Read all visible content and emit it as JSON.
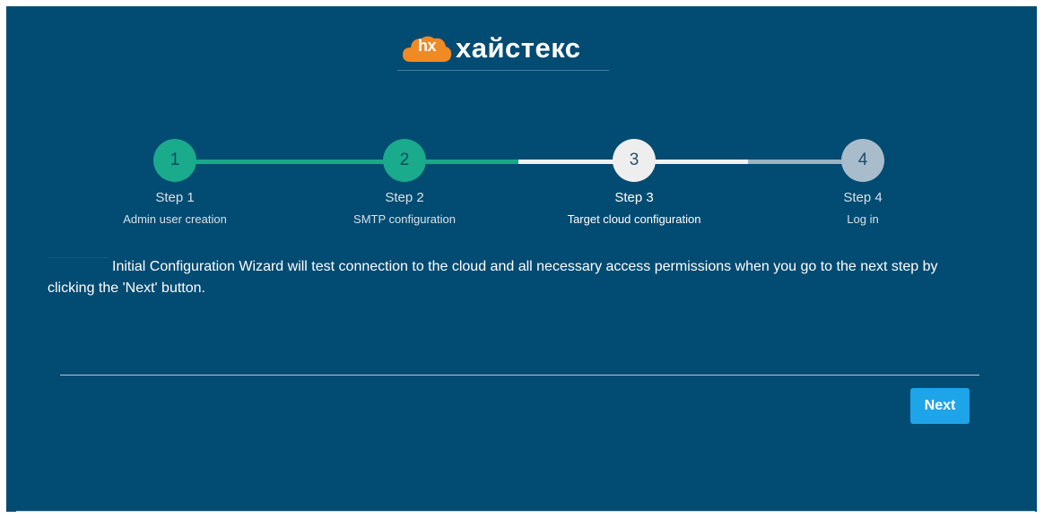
{
  "logo": {
    "mark_text": "hx",
    "word": "хайстекс",
    "cloud_color": "#f08a24"
  },
  "stepper": {
    "current_step": 3,
    "steps": [
      {
        "number": "1",
        "title": "Step 1",
        "subtitle": "Admin user creation",
        "status": "done"
      },
      {
        "number": "2",
        "title": "Step 2",
        "subtitle": "SMTP configuration",
        "status": "done"
      },
      {
        "number": "3",
        "title": "Step 3",
        "subtitle": "Target cloud configuration",
        "status": "current"
      },
      {
        "number": "4",
        "title": "Step 4",
        "subtitle": "Log in",
        "status": "future"
      }
    ]
  },
  "message": {
    "text": "Initial Configuration Wizard will test connection to the cloud and all necessary access permissions when you go to the next step by clicking the 'Next' button."
  },
  "footer": {
    "next_label": "Next"
  },
  "colors": {
    "background": "#024b72",
    "done": "#1aaa8c",
    "current": "#eeeeee",
    "future": "#a9bccb",
    "button": "#1ea4e9"
  }
}
